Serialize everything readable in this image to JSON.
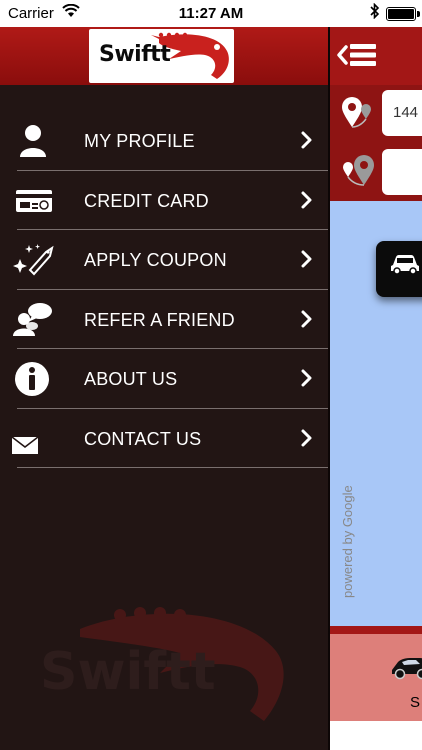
{
  "status_bar": {
    "carrier": "Carrier",
    "time": "11:27 AM"
  },
  "app": {
    "logo_text": "Swiftt"
  },
  "menu": {
    "items": [
      {
        "label": "MY PROFILE",
        "icon": "person-icon"
      },
      {
        "label": "CREDIT CARD",
        "icon": "credit-card-icon"
      },
      {
        "label": "APPLY COUPON",
        "icon": "coupon-tag-icon"
      },
      {
        "label": "REFER A FRIEND",
        "icon": "refer-friend-icon"
      },
      {
        "label": "ABOUT US",
        "icon": "info-icon"
      },
      {
        "label": "CONTACT US",
        "icon": "mail-icon"
      }
    ]
  },
  "main": {
    "pickup_value": "144",
    "dropoff_value": "",
    "map_attribution": "powered by Google",
    "bottom_label": "S"
  },
  "colors": {
    "header_red": "#a31716",
    "drawer_bg": "#221514",
    "map_blue": "#a8c7f7",
    "bottom_pink": "#dd7f7a"
  }
}
